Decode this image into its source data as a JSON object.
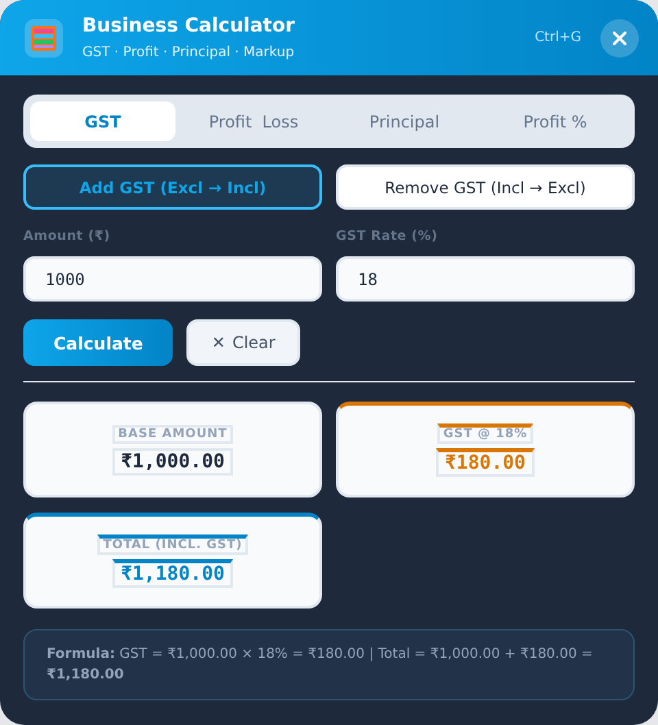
{
  "window": {
    "title": "Business Calculator",
    "subtitle": "GST · Profit · Principal · Markup",
    "shortcut": "Ctrl+G"
  },
  "tabs": [
    {
      "label": "GST",
      "selected": true
    },
    {
      "label": "Profit  Loss",
      "selected": false
    },
    {
      "label": "Principal",
      "selected": false
    },
    {
      "label": "Profit %",
      "selected": false
    }
  ],
  "modes": [
    {
      "label": "Add GST (Excl → Incl)",
      "selected": true
    },
    {
      "label": "Remove GST (Incl → Excl)",
      "selected": false
    }
  ],
  "fields": [
    {
      "label": "Amount (₹)",
      "value": "1000"
    },
    {
      "label": "GST Rate (%)",
      "value": "18"
    }
  ],
  "actions": {
    "calculate": "Calculate",
    "clear_icon": "✕",
    "clear": "Clear"
  },
  "results": [
    {
      "label": "BASE AMOUNT",
      "value": "₹1,000.00",
      "kind": "plain",
      "color": "#1e293b"
    },
    {
      "label": "GST @ 18%",
      "value": "₹180.00",
      "kind": "accent",
      "color": "#d97706"
    },
    {
      "label": "TOTAL (INCL. GST)",
      "value": "₹1,180.00",
      "kind": "accent",
      "color": "#0284c7"
    }
  ],
  "formula": "**Formula:** GST = ₹1,000.00 × 18% = ₹180.00  |  Total = ₹1,000.00 + ₹180.00 = **₹1,180.00**"
}
